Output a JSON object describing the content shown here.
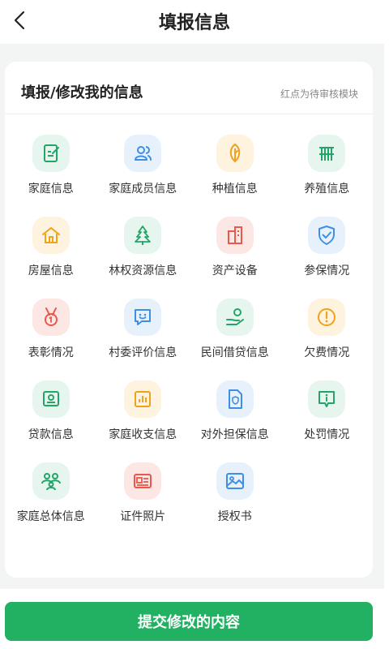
{
  "header": {
    "title": "填报信息"
  },
  "card": {
    "title": "填报/修改我的信息",
    "note": "红点为待审核模块"
  },
  "items": [
    {
      "label": "家庭信息"
    },
    {
      "label": "家庭成员信息"
    },
    {
      "label": "种植信息"
    },
    {
      "label": "养殖信息"
    },
    {
      "label": "房屋信息"
    },
    {
      "label": "林权资源信息"
    },
    {
      "label": "资产设备"
    },
    {
      "label": "参保情况"
    },
    {
      "label": "表彰情况"
    },
    {
      "label": "村委评价信息"
    },
    {
      "label": "民间借贷信息"
    },
    {
      "label": "欠费情况"
    },
    {
      "label": "贷款信息"
    },
    {
      "label": "家庭收支信息"
    },
    {
      "label": "对外担保信息"
    },
    {
      "label": "处罚情况"
    },
    {
      "label": "家庭总体信息"
    },
    {
      "label": "证件照片"
    },
    {
      "label": "授权书"
    }
  ],
  "footer": {
    "submit_label": "提交修改的内容"
  },
  "colors": {
    "green": "#23a567",
    "green_bg": "#e6f6ee",
    "blue": "#3f8ee6",
    "blue_bg": "#e6f1fc",
    "orange": "#f0a21a",
    "orange_bg": "#fdf3df",
    "red": "#e9584a",
    "red_bg": "#fde7e4",
    "button": "#22b163"
  }
}
